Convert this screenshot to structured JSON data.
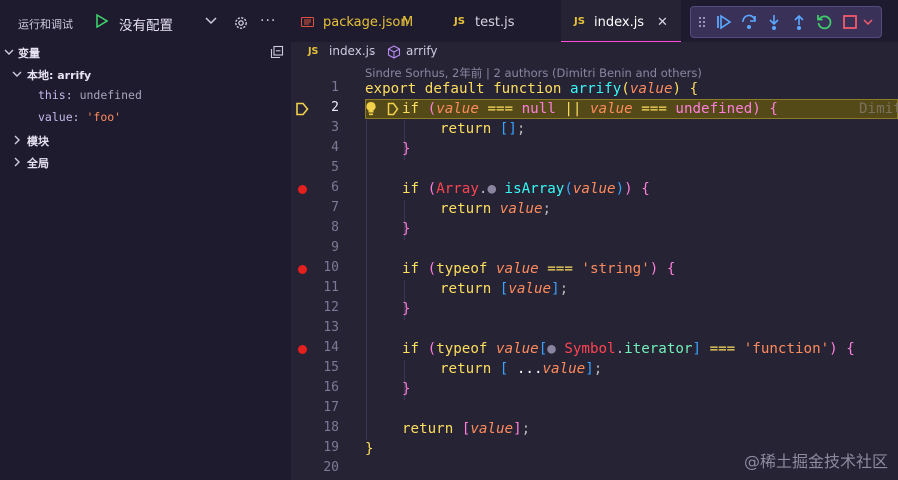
{
  "sidebar": {
    "title": "运行和调试",
    "config_label": "没有配置",
    "more": "···",
    "variables_header": "变量",
    "local_scope": "本地: arrify",
    "variables": [
      {
        "name": "this",
        "sep": ": ",
        "value": "undefined"
      },
      {
        "name": "value",
        "sep": ": ",
        "value": "'foo'"
      }
    ],
    "module_scope": "模块",
    "global_scope": "全局"
  },
  "tabs": [
    {
      "icon": "json-icon",
      "label": "package.json",
      "badge": "M"
    },
    {
      "icon": "js-icon",
      "icon_text": "JS",
      "label": "test.js"
    },
    {
      "icon": "js-icon",
      "icon_text": "JS",
      "label": "index.js",
      "active": true,
      "close": "✕"
    }
  ],
  "breadcrumb": {
    "js": "JS",
    "file": "index.js",
    "sep": "›",
    "symbol": "arrify"
  },
  "editor": {
    "blame": "Sindre Sorhus, 2年前 | 2 authors (Dimitri Benin and others)",
    "current_line": 2,
    "breakpoint_lines": [
      6,
      10,
      14
    ],
    "inline_blame_fragment": "Dimit",
    "line_numbers": [
      "1",
      "2",
      "3",
      "4",
      "5",
      "6",
      "7",
      "8",
      "9",
      "10",
      "11",
      "12",
      "13",
      "14",
      "15",
      "16",
      "17",
      "18",
      "19",
      "20"
    ]
  },
  "watermark": "@稀土掘金技术社区",
  "colors": {
    "accent": "#ff4bd6",
    "current_line": "#544a18",
    "breakpoint": "#e51e1e"
  }
}
